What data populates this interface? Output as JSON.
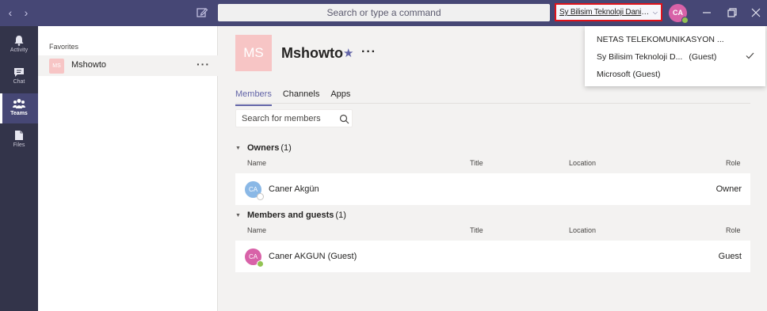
{
  "titlebar": {
    "search_placeholder": "Search or type a command",
    "org_current": "Sy Bilisim Teknoloji Danismanl...",
    "user_initials": "CA"
  },
  "appbar": {
    "items": [
      {
        "label": "Activity",
        "icon": "bell-icon"
      },
      {
        "label": "Chat",
        "icon": "chat-icon"
      },
      {
        "label": "Teams",
        "icon": "teams-icon",
        "active": true
      },
      {
        "label": "Files",
        "icon": "files-icon"
      }
    ]
  },
  "teamlist": {
    "section_label": "Favorites",
    "teams": [
      {
        "initials": "MS",
        "name": "Mshowto"
      }
    ]
  },
  "team": {
    "initials": "MS",
    "name": "Mshowto"
  },
  "tabs": [
    {
      "label": "Members",
      "active": true
    },
    {
      "label": "Channels"
    },
    {
      "label": "Apps"
    }
  ],
  "member_search": {
    "placeholder": "Search for members"
  },
  "columns": {
    "name": "Name",
    "title": "Title",
    "location": "Location",
    "role": "Role"
  },
  "sections": [
    {
      "label": "Owners",
      "count": "(1)",
      "members": [
        {
          "initials": "CA",
          "name": "Caner Akgün",
          "role": "Owner",
          "avatar_color": "#8ab8e6",
          "badge_color": "#ffffff"
        }
      ]
    },
    {
      "label": "Members and guests",
      "count": "(1)",
      "members": [
        {
          "initials": "CA",
          "name": "Caner AKGUN (Guest)",
          "role": "Guest",
          "avatar_color": "#d862a8",
          "badge_color": "#92c353"
        }
      ]
    }
  ],
  "org_menu": {
    "items": [
      {
        "name": "NETAS TELEKOMUNIKASYON ...",
        "suffix": ""
      },
      {
        "name": "Sy Bilisim Teknoloji D...",
        "suffix": "(Guest)",
        "selected": true
      },
      {
        "name": "Microsoft",
        "suffix": "(Guest)"
      }
    ]
  },
  "colors": {
    "titlebar": "#464775",
    "appbar": "#33344a",
    "accent": "#6264a7",
    "highlight_border": "#e0121a"
  }
}
